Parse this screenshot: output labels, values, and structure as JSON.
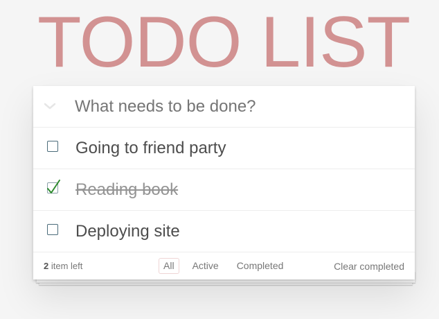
{
  "app": {
    "title": "TODO LIST"
  },
  "input": {
    "placeholder": "What needs to be done?",
    "value": ""
  },
  "todos": [
    {
      "label": "Going to friend party",
      "completed": false
    },
    {
      "label": "Reading book",
      "completed": true
    },
    {
      "label": "Deploying site",
      "completed": false
    }
  ],
  "footer": {
    "count": "2",
    "count_suffix": "item left",
    "filters": [
      {
        "label": "All",
        "selected": true
      },
      {
        "label": "Active",
        "selected": false
      },
      {
        "label": "Completed",
        "selected": false
      }
    ],
    "clear_label": "Clear completed"
  },
  "icons": {
    "toggle_all": "chevron-down-icon",
    "checkmark": "checkmark-icon"
  },
  "colors": {
    "title": "#d49a9a",
    "checkmark": "#2e8b2e",
    "background": "#f5f5f5"
  }
}
